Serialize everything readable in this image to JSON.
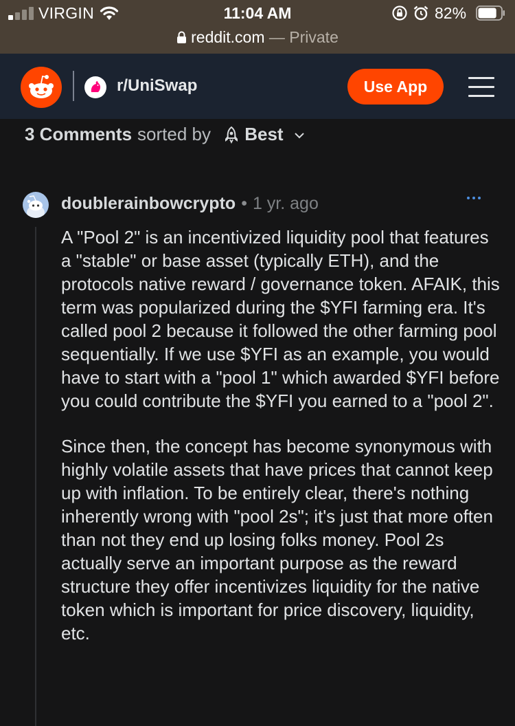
{
  "status_bar": {
    "carrier": "VIRGIN",
    "time": "11:04 AM",
    "battery": "82%",
    "battery_level": 0.82
  },
  "url_bar": {
    "domain": "reddit.com",
    "mode": "— Private"
  },
  "header": {
    "subreddit": "r/UniSwap",
    "use_app": "Use App",
    "icons": [
      "reddit-logo-icon",
      "uniswap-unicorn-icon",
      "hamburger-menu-icon"
    ]
  },
  "sort_bar": {
    "count": "3 Comments",
    "sorted_by": "sorted by",
    "sort_value": "Best"
  },
  "comment": {
    "username": "doublerainbowcrypto",
    "age": "1 yr. ago",
    "paragraphs": [
      "A \"Pool 2\" is an incentivized liquidity pool that features a \"stable\" or base asset (typically ETH), and the protocols native reward / governance token. AFAIK, this term was popularized during the $YFI farming era. It's called pool 2 because it followed the other farming pool sequentially. If we use $YFI as an example, you would have to start with a \"pool 1\" which awarded $YFI before you could contribute the $YFI you earned to a \"pool 2\".",
      "Since then, the concept has become synonymous with highly volatile assets that have prices that cannot keep up with inflation. To be entirely clear, there's nothing inherently wrong with \"pool 2s\"; it's just that more often than not they end up losing folks money. Pool 2s actually serve an important purpose as the reward structure they offer incentivizes liquidity for the native token which is important for price discovery, liquidity, etc."
    ]
  },
  "colors": {
    "accent": "#ff4500",
    "background": "#151516",
    "header": "#1b2330",
    "status_bar": "#4a4035",
    "link_blue": "#4d8fe0"
  }
}
